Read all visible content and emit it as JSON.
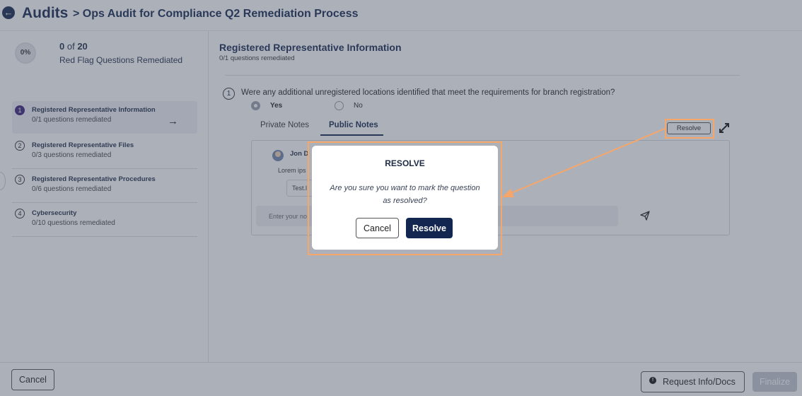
{
  "header": {
    "back_icon": "arrow-left-circle-icon",
    "title": "Audits",
    "breadcrumb": "> Ops Audit for Compliance Q2 Remediation Process"
  },
  "progress": {
    "percent_label": "0%",
    "completed": "0",
    "of_label": "of",
    "total": "20",
    "label": "Red Flag Questions Remediated"
  },
  "steps": [
    {
      "number": "1",
      "title": "Registered Representative Information",
      "subtitle": "0/1 questions remediated",
      "active": true
    },
    {
      "number": "2",
      "title": "Registered Representative Files",
      "subtitle": "0/3 questions remediated"
    },
    {
      "number": "3",
      "title": "Registered Representative Procedures",
      "subtitle": "0/6 questions remediated"
    },
    {
      "number": "4",
      "title": "Cybersecurity",
      "subtitle": "0/10 questions remediated"
    }
  ],
  "main": {
    "title": "Registered Representative Information",
    "subtitle": "0/1 questions remediated",
    "question": {
      "number": "1",
      "text": "Were any additional unregistered locations identified that meet the requirements for branch registration?",
      "options": [
        {
          "label": "Yes",
          "selected": true
        },
        {
          "label": "No",
          "selected": false
        }
      ]
    },
    "tabs": [
      {
        "label": "Private Notes",
        "active": false
      },
      {
        "label": "Public Notes",
        "active": true
      }
    ],
    "resolve_label": "Resolve",
    "note": {
      "author": "Jon D",
      "text": "Lorem ips",
      "attachment": "Test.l"
    },
    "note_input_placeholder": "Enter your no"
  },
  "footer": {
    "cancel_label": "Cancel",
    "request_label": "Request Info/Docs",
    "finalize_label": "Finalize"
  },
  "modal": {
    "title": "RESOLVE",
    "message": "Are you sure you want to mark the question as resolved?",
    "cancel_label": "Cancel",
    "confirm_label": "Resolve"
  },
  "colors": {
    "primary": "#13264f",
    "highlight": "#f7a66a",
    "overlay": "rgba(70,80,100,0.45)",
    "disabled": "#c3c7cf"
  }
}
